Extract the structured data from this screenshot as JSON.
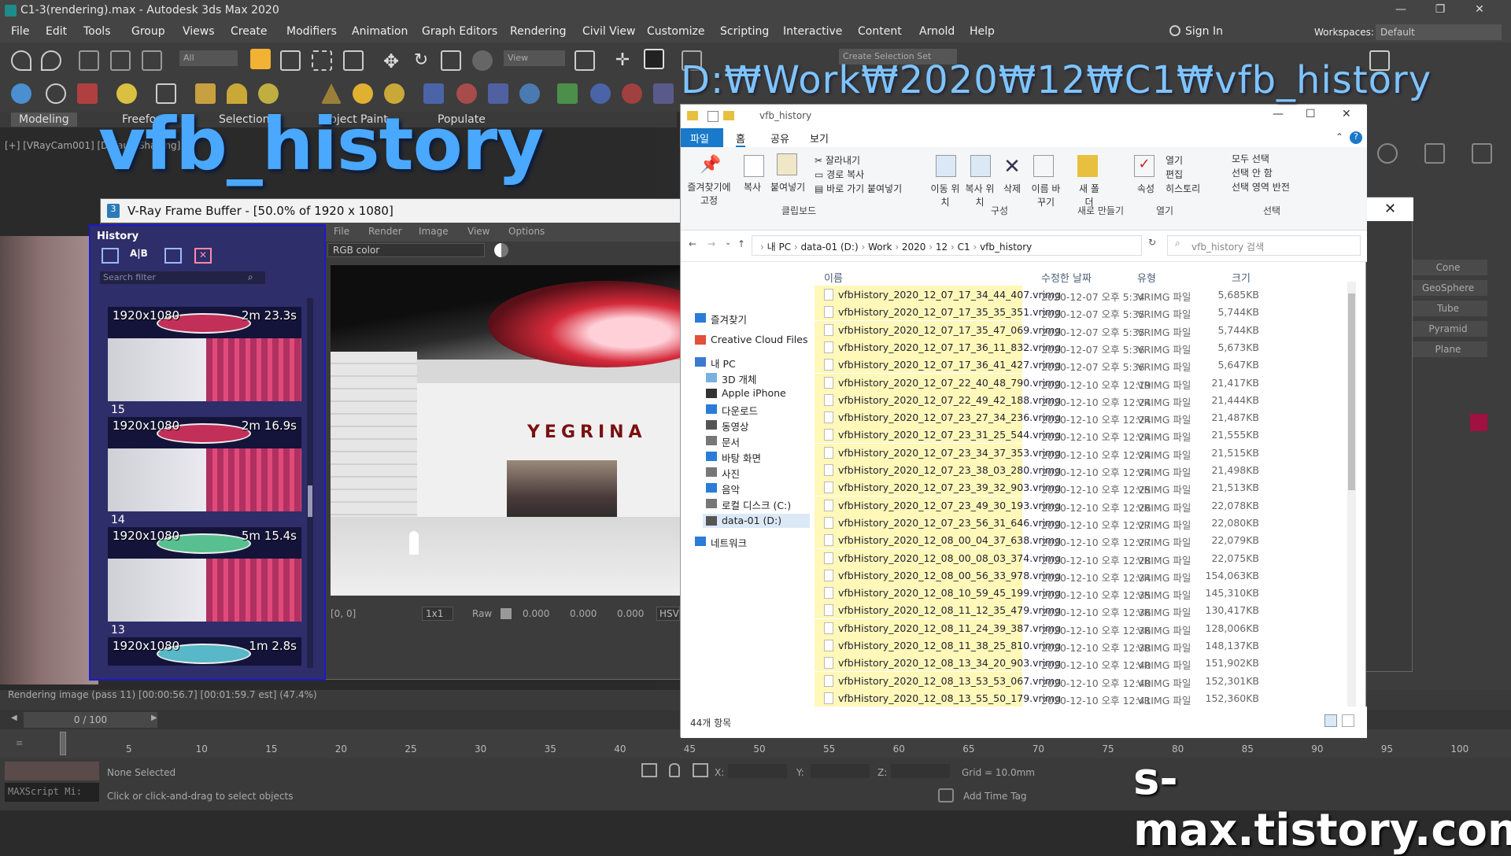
{
  "app": {
    "title": "C1-3(rendering).max - Autodesk 3ds Max 2020",
    "menu": [
      "File",
      "Edit",
      "Tools",
      "Group",
      "Views",
      "Create",
      "Modifiers",
      "Animation",
      "Graph Editors",
      "Rendering",
      "Civil View",
      "Customize",
      "Scripting",
      "Interactive",
      "Content",
      "Arnold",
      "Help"
    ],
    "sign_in": "Sign In",
    "workspaces_label": "Workspaces:",
    "workspaces_value": "Default",
    "toolbar_all": "All",
    "toolbar_view": "View",
    "selection_set": "Create Selection Set",
    "ribbon_tabs": [
      "Modeling",
      "Freeform",
      "Selection",
      "Object Paint",
      "Populate"
    ],
    "viewport_label": "[+] [VRayCam001] [Default Shading]",
    "status_rendering": "Rendering image (pass 11) [00:00:56.7] [00:01:59.7 est]",
    "status_percent": "(47.4%)",
    "frame_counter": "0 / 100",
    "none_selected": "None Selected",
    "hint": "Click or click-and-drag to select objects",
    "maxscript": "MAXScript Mi:",
    "grid": "Grid = 10.0mm",
    "add_time_tag": "Add Time Tag",
    "x_label": "X:",
    "y_label": "Y:",
    "z_label": "Z:",
    "timeline_ticks": [
      "5",
      "10",
      "15",
      "20",
      "25",
      "30",
      "35",
      "40",
      "45",
      "50",
      "55",
      "60",
      "65",
      "70",
      "75",
      "80",
      "85",
      "90",
      "95",
      "100"
    ],
    "cmd_panel": [
      "Cone",
      "GeoSphere",
      "Tube",
      "Pyramid",
      "Plane"
    ]
  },
  "captions": {
    "path": "D:₩Work₩2020₩12₩C1₩vfb_history",
    "vfb_history": "vfb_history",
    "site": "s-max.tistory.com"
  },
  "vfb": {
    "title": "V-Ray Frame Buffer - [50.0% of 1920 x 1080]",
    "menu": [
      "File",
      "Render",
      "Image",
      "View",
      "Options"
    ],
    "history_title": "History",
    "search_placeholder": "Search filter",
    "channel": "RGB color",
    "coords": "[0, 0]",
    "zoom": "1x1",
    "raw": "Raw",
    "rgb_values": [
      "0.000",
      "0.000",
      "0.000"
    ],
    "hsv": "HSV",
    "thumbs": [
      {
        "res": "1920x1080",
        "time": "2m 23.3s",
        "num": "15"
      },
      {
        "res": "1920x1080",
        "time": "2m 16.9s",
        "num": "14"
      },
      {
        "res": "1920x1080",
        "time": "5m 15.4s",
        "num": "13"
      },
      {
        "res": "1920x1080",
        "time": "1m 2.8s",
        "num": ""
      }
    ],
    "sign_text": "YEGRINA"
  },
  "explorer": {
    "title": "vfb_history",
    "tabs": [
      "파일",
      "홈",
      "공유",
      "보기"
    ],
    "ribbon": {
      "pin": "즐겨찾기에 고정",
      "copy": "복사",
      "paste": "붙여넣기",
      "cut": "잘라내기",
      "copy_path": "경로 복사",
      "paste_shortcut": "바로 가기 붙여넣기",
      "move_to": "이동 위치",
      "copy_to": "복사 위치",
      "delete": "삭제",
      "rename": "이름 바꾸기",
      "new_folder": "새 폴더",
      "properties": "속성",
      "open": "열기",
      "edit": "편집",
      "history": "히스토리",
      "select_all": "모두 선택",
      "select_none": "선택 안 함",
      "invert": "선택 영역 반전",
      "groups": [
        "클립보드",
        "구성",
        "새로 만들기",
        "열기",
        "선택"
      ]
    },
    "breadcrumb": [
      "내 PC",
      "data-01 (D:)",
      "Work",
      "2020",
      "12",
      "C1",
      "vfb_history"
    ],
    "search_placeholder": "vfb_history 검색",
    "nav": [
      "즐겨찾기",
      "Creative Cloud Files",
      "내 PC",
      "3D 개체",
      "Apple iPhone",
      "다운로드",
      "동영상",
      "문서",
      "바탕 화면",
      "사진",
      "음악",
      "로컬 디스크 (C:)",
      "data-01 (D:)",
      "네트워크"
    ],
    "columns": [
      "이름",
      "수정한 날짜",
      "유형",
      "크기"
    ],
    "files": [
      [
        "vfbHistory_2020_12_07_17_34_44_407.vrimg",
        "2020-12-07 오후 5:34",
        "VRIMG 파일",
        "5,685KB"
      ],
      [
        "vfbHistory_2020_12_07_17_35_35_351.vrimg",
        "2020-12-07 오후 5:35",
        "VRIMG 파일",
        "5,744KB"
      ],
      [
        "vfbHistory_2020_12_07_17_35_47_069.vrimg",
        "2020-12-07 오후 5:35",
        "VRIMG 파일",
        "5,744KB"
      ],
      [
        "vfbHistory_2020_12_07_17_36_11_832.vrimg",
        "2020-12-07 오후 5:36",
        "VRIMG 파일",
        "5,673KB"
      ],
      [
        "vfbHistory_2020_12_07_17_36_41_427.vrimg",
        "2020-12-07 오후 5:36",
        "VRIMG 파일",
        "5,647KB"
      ],
      [
        "vfbHistory_2020_12_07_22_40_48_790.vrimg",
        "2020-12-10 오후 12:19",
        "VRIMG 파일",
        "21,417KB"
      ],
      [
        "vfbHistory_2020_12_07_22_49_42_188.vrimg",
        "2020-12-10 오후 12:24",
        "VRIMG 파일",
        "21,444KB"
      ],
      [
        "vfbHistory_2020_12_07_23_27_34_236.vrimg",
        "2020-12-10 오후 12:24",
        "VRIMG 파일",
        "21,487KB"
      ],
      [
        "vfbHistory_2020_12_07_23_31_25_544.vrimg",
        "2020-12-10 오후 12:24",
        "VRIMG 파일",
        "21,555KB"
      ],
      [
        "vfbHistory_2020_12_07_23_34_37_353.vrimg",
        "2020-12-10 오후 12:24",
        "VRIMG 파일",
        "21,515KB"
      ],
      [
        "vfbHistory_2020_12_07_23_38_03_280.vrimg",
        "2020-12-10 오후 12:24",
        "VRIMG 파일",
        "21,498KB"
      ],
      [
        "vfbHistory_2020_12_07_23_39_32_903.vrimg",
        "2020-12-10 오후 12:25",
        "VRIMG 파일",
        "21,513KB"
      ],
      [
        "vfbHistory_2020_12_07_23_49_30_193.vrimg",
        "2020-12-10 오후 12:26",
        "VRIMG 파일",
        "22,078KB"
      ],
      [
        "vfbHistory_2020_12_07_23_56_31_646.vrimg",
        "2020-12-10 오후 12:27",
        "VRIMG 파일",
        "22,080KB"
      ],
      [
        "vfbHistory_2020_12_08_00_04_37_638.vrimg",
        "2020-12-10 오후 12:27",
        "VRIMG 파일",
        "22,079KB"
      ],
      [
        "vfbHistory_2020_12_08_00_08_03_374.vrimg",
        "2020-12-10 오후 12:28",
        "VRIMG 파일",
        "22,075KB"
      ],
      [
        "vfbHistory_2020_12_08_00_56_33_978.vrimg",
        "2020-12-10 오후 12:34",
        "VRIMG 파일",
        "154,063KB"
      ],
      [
        "vfbHistory_2020_12_08_10_59_45_199.vrimg",
        "2020-12-10 오후 12:35",
        "VRIMG 파일",
        "145,310KB"
      ],
      [
        "vfbHistory_2020_12_08_11_12_35_479.vrimg",
        "2020-12-10 오후 12:36",
        "VRIMG 파일",
        "130,417KB"
      ],
      [
        "vfbHistory_2020_12_08_11_24_39_387.vrimg",
        "2020-12-10 오후 12:36",
        "VRIMG 파일",
        "128,006KB"
      ],
      [
        "vfbHistory_2020_12_08_11_38_25_810.vrimg",
        "2020-12-10 오후 12:38",
        "VRIMG 파일",
        "148,137KB"
      ],
      [
        "vfbHistory_2020_12_08_13_34_20_903.vrimg",
        "2020-12-10 오후 12:40",
        "VRIMG 파일",
        "151,902KB"
      ],
      [
        "vfbHistory_2020_12_08_13_53_53_067.vrimg",
        "2020-12-10 오후 12:40",
        "VRIMG 파일",
        "152,301KB"
      ],
      [
        "vfbHistory_2020_12_08_13_55_50_179.vrimg",
        "2020-12-10 오후 12:41",
        "VRIMG 파일",
        "152,360KB"
      ]
    ],
    "item_count": "44개 항목"
  }
}
